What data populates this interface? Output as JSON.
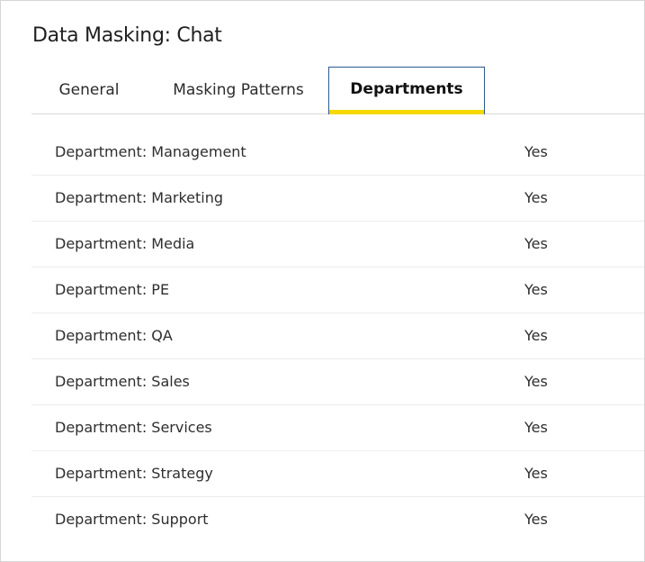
{
  "page": {
    "title": "Data Masking: Chat"
  },
  "tabs": [
    {
      "label": "General",
      "active": false
    },
    {
      "label": "Masking Patterns",
      "active": false
    },
    {
      "label": "Departments",
      "active": true
    }
  ],
  "colors": {
    "active_tab_border": "#2c5a8c",
    "active_tab_underline": "#f5d800",
    "row_divider": "#ececec"
  },
  "departments": [
    {
      "label": "Department: Management",
      "value": "Yes"
    },
    {
      "label": "Department: Marketing",
      "value": "Yes"
    },
    {
      "label": "Department: Media",
      "value": "Yes"
    },
    {
      "label": "Department: PE",
      "value": "Yes"
    },
    {
      "label": "Department: QA",
      "value": "Yes"
    },
    {
      "label": "Department: Sales",
      "value": "Yes"
    },
    {
      "label": "Department: Services",
      "value": "Yes"
    },
    {
      "label": "Department: Strategy",
      "value": "Yes"
    },
    {
      "label": "Department: Support",
      "value": "Yes"
    }
  ]
}
